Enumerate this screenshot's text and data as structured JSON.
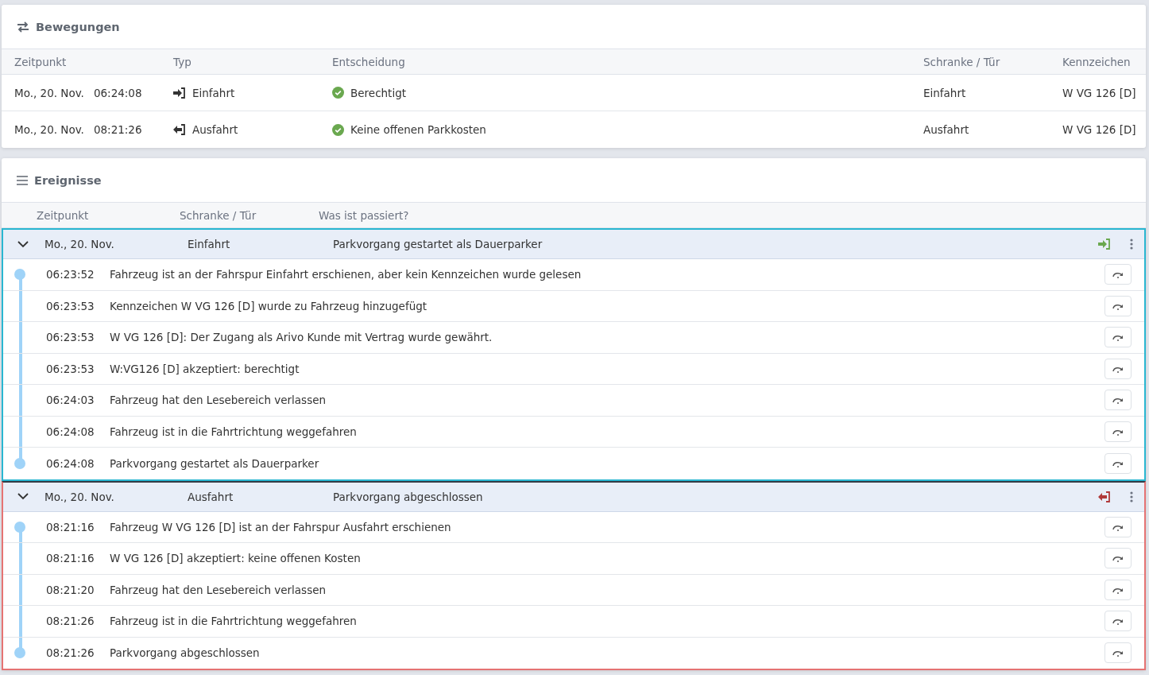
{
  "movements": {
    "title": "Bewegungen",
    "columns": [
      "Zeitpunkt",
      "Typ",
      "Entscheidung",
      "Schranke / Tür",
      "Kennzeichen"
    ],
    "rows": [
      {
        "date": "Mo., 20. Nov.",
        "time": "06:24:08",
        "kind": "entry",
        "type": "Einfahrt",
        "decision": "Berechtigt",
        "gate": "Einfahrt",
        "plate": "W VG 126 [D]"
      },
      {
        "date": "Mo., 20. Nov.",
        "time": "08:21:26",
        "kind": "exit",
        "type": "Ausfahrt",
        "decision": "Keine offenen Parkkosten",
        "gate": "Ausfahrt",
        "plate": "W VG 126 [D]"
      }
    ]
  },
  "events": {
    "title": "Ereignisse",
    "columns": [
      "Zeitpunkt",
      "Schranke / Tür",
      "Was ist passiert?"
    ],
    "groups": [
      {
        "date": "Mo., 20. Nov.",
        "gate": "Einfahrt",
        "summary": "Parkvorgang gestartet als Dauerparker",
        "kind": "entry",
        "color": "#29b6d1",
        "expanded": true,
        "items": [
          {
            "time": "06:23:52",
            "text": "Fahrzeug ist an der Fahrspur Einfahrt erschienen, aber kein Kennzeichen wurde gelesen"
          },
          {
            "time": "06:23:53",
            "text": "Kennzeichen W VG 126 [D] wurde zu Fahrzeug hinzugefügt"
          },
          {
            "time": "06:23:53",
            "text": "W VG 126 [D]: Der Zugang als Arivo Kunde mit Vertrag wurde gewährt."
          },
          {
            "time": "06:23:53",
            "text": "W:VG126 [D] akzeptiert: berechtigt"
          },
          {
            "time": "06:24:03",
            "text": "Fahrzeug hat den Lesebereich verlassen"
          },
          {
            "time": "06:24:08",
            "text": "Fahrzeug ist in die Fahrtrichtung weggefahren"
          },
          {
            "time": "06:24:08",
            "text": "Parkvorgang gestartet als Dauerparker"
          }
        ]
      },
      {
        "date": "Mo., 20. Nov.",
        "gate": "Ausfahrt",
        "summary": "Parkvorgang abgeschlossen",
        "kind": "exit",
        "color": "#e57373",
        "expanded": true,
        "items": [
          {
            "time": "08:21:16",
            "text": "Fahrzeug W VG 126 [D] ist an der Fahrspur Ausfahrt erschienen"
          },
          {
            "time": "08:21:16",
            "text": "W VG 126 [D] akzeptiert: keine offenen Kosten"
          },
          {
            "time": "08:21:20",
            "text": "Fahrzeug hat den Lesebereich verlassen"
          },
          {
            "time": "08:21:26",
            "text": "Fahrzeug ist in die Fahrtrichtung weggefahren"
          },
          {
            "time": "08:21:26",
            "text": "Parkvorgang abgeschlossen"
          }
        ]
      }
    ]
  }
}
